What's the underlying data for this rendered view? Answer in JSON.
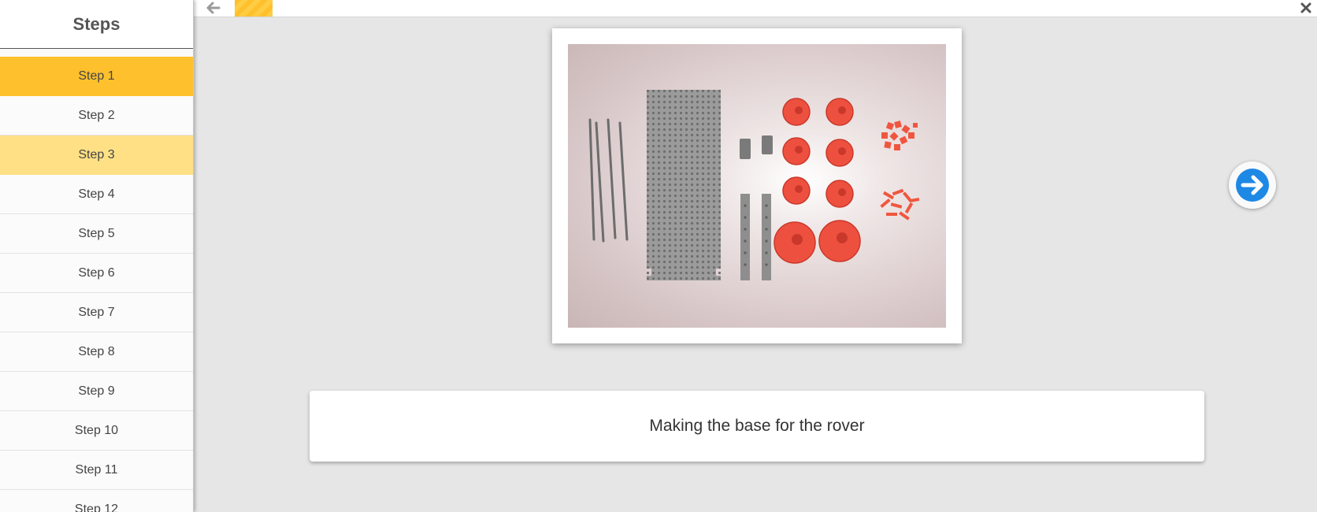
{
  "sidebar": {
    "title": "Steps",
    "active_index": 0,
    "hover_index": 2,
    "items": [
      {
        "label": "Step 1"
      },
      {
        "label": "Step 2"
      },
      {
        "label": "Step 3"
      },
      {
        "label": "Step 4"
      },
      {
        "label": "Step 5"
      },
      {
        "label": "Step 6"
      },
      {
        "label": "Step 7"
      },
      {
        "label": "Step 8"
      },
      {
        "label": "Step 9"
      },
      {
        "label": "Step 10"
      },
      {
        "label": "Step 11"
      },
      {
        "label": "Step 12"
      }
    ]
  },
  "topbar": {
    "back_icon": "arrow-left-icon",
    "close_icon": "close-icon"
  },
  "photo": {
    "subject": "rover kit parts"
  },
  "navigation": {
    "next_icon": "arrow-right-circle-icon"
  },
  "caption": {
    "text": "Making the base for the rover"
  },
  "colors": {
    "accent": "#fec12d",
    "accent_light": "#ffe085",
    "next_blue": "#1e88e5",
    "part_red": "#ee5040"
  }
}
